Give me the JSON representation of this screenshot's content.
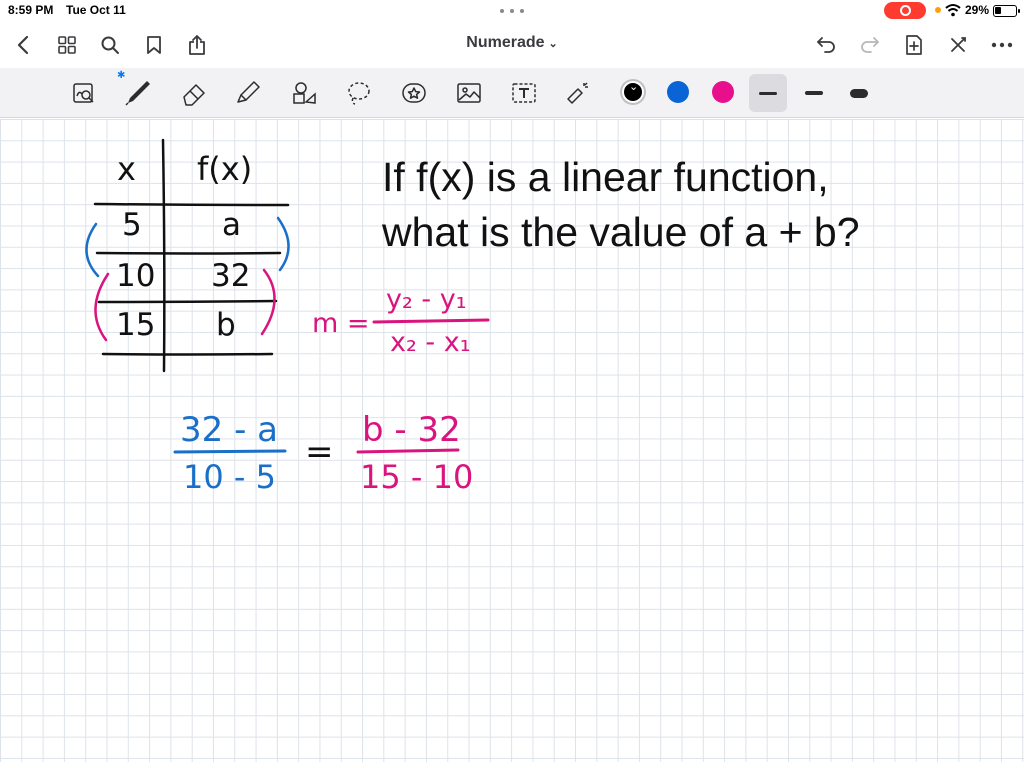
{
  "status": {
    "time": "8:59 PM",
    "date": "Tue Oct 11",
    "battery": "29%"
  },
  "nav": {
    "title": "Numerade",
    "icons": [
      "back-icon",
      "grid-icon",
      "search-icon",
      "bookmark-icon",
      "share-icon",
      "undo-icon",
      "redo-icon",
      "add-page-icon",
      "close-icon",
      "more-icon"
    ]
  },
  "toolbar": {
    "tools": [
      "lasso-zoom-icon",
      "pen-icon",
      "eraser-icon",
      "highlighter-icon",
      "shapes-icon",
      "lasso-icon",
      "sticker-icon",
      "image-icon",
      "text-icon",
      "laser-pointer-icon"
    ],
    "colors": {
      "black": "#000000",
      "blue": "#0a64d6",
      "pink": "#e80f8c"
    },
    "selected_color": "black"
  },
  "question": {
    "line1": "If f(x) is a linear function,",
    "line2": "what is the value of a + b?"
  },
  "table": {
    "headers": [
      "x",
      "f(x)"
    ],
    "rows": [
      {
        "x": "5",
        "fx": "a"
      },
      {
        "x": "10",
        "fx": "32"
      },
      {
        "x": "15",
        "fx": "b"
      }
    ]
  },
  "slope_formula": {
    "lhs": "m =",
    "numerator": "y₂ - y₁",
    "denominator": "x₂ - x₁"
  },
  "equation": {
    "left_numerator": "32 - a",
    "left_denominator": "10 - 5",
    "equals": "=",
    "right_numerator": "b - 32",
    "right_denominator": "15 - 10"
  }
}
